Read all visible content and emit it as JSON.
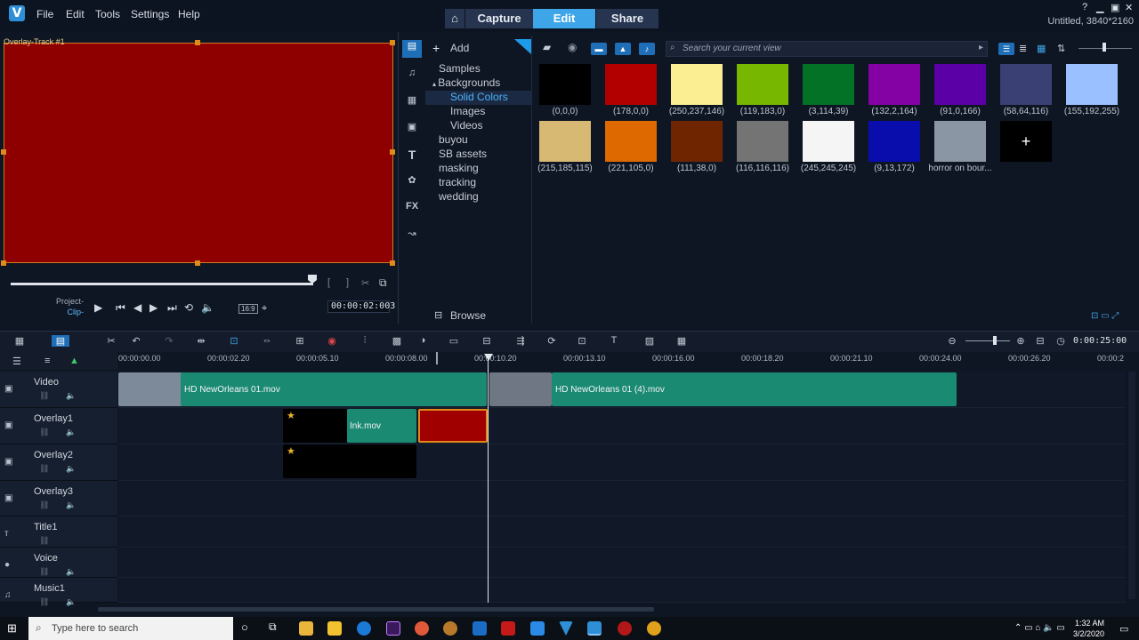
{
  "app": {
    "logo": "V",
    "menus": [
      "File",
      "Edit",
      "Tools",
      "Settings",
      "Help"
    ],
    "workspaces": [
      "Capture",
      "Edit",
      "Share"
    ],
    "active_workspace": "Edit",
    "project_info": "Untitled, 3840*2160"
  },
  "preview": {
    "track_label": "Overlay-Track #1",
    "canvas_color": "#8e0000",
    "project_label": "Project-",
    "clip_label": "Clip-",
    "aspect": "16:9",
    "timecode": "00:00:02:003"
  },
  "library": {
    "add_label": "Add",
    "search_placeholder": "Search your current view",
    "browse_label": "Browse",
    "tree": [
      {
        "label": "Samples",
        "indent": 1
      },
      {
        "label": "Backgrounds",
        "indent": 1,
        "arrow": "▴"
      },
      {
        "label": "Solid Colors",
        "indent": 2,
        "selected": true
      },
      {
        "label": "Images",
        "indent": 2
      },
      {
        "label": "Videos",
        "indent": 2
      },
      {
        "label": "buyou",
        "indent": 0
      },
      {
        "label": "SB assets",
        "indent": 0
      },
      {
        "label": "masking",
        "indent": 0
      },
      {
        "label": "tracking",
        "indent": 0
      },
      {
        "label": "wedding",
        "indent": 0
      }
    ],
    "swatches": [
      {
        "label": "(0,0,0)",
        "color": "#000000"
      },
      {
        "label": "(178,0,0)",
        "color": "#b20000"
      },
      {
        "label": "(250,237,146)",
        "color": "#faed92"
      },
      {
        "label": "(119,183,0)",
        "color": "#77b700"
      },
      {
        "label": "(3,114,39)",
        "color": "#037227"
      },
      {
        "label": "(132,2,164)",
        "color": "#8402a4"
      },
      {
        "label": "(91,0,166)",
        "color": "#5b00a6"
      },
      {
        "label": "(58,64,116)",
        "color": "#3a4074"
      },
      {
        "label": "(155,192,255)",
        "color": "#9bc0ff"
      },
      {
        "label": "(215,185,115)",
        "color": "#d7b973"
      },
      {
        "label": "(221,105,0)",
        "color": "#dd6900"
      },
      {
        "label": "(111,38,0)",
        "color": "#6f2600"
      },
      {
        "label": "(116,116,116)",
        "color": "#747474"
      },
      {
        "label": "(245,245,245)",
        "color": "#f5f5f5"
      },
      {
        "label": "(9,13,172)",
        "color": "#090dac"
      },
      {
        "label": "horror on bour...",
        "color": "#8a96a4"
      },
      {
        "label": "",
        "color": "#000000",
        "plus": "+"
      }
    ]
  },
  "timeline": {
    "zoom_time": "0:00:25:00",
    "ticks": [
      "00:00:00.00",
      "00:00:02.20",
      "00:00:05.10",
      "00:00:08.00",
      "00:00:10.20",
      "00:00:13.10",
      "00:00:16.00",
      "00:00:18.20",
      "00:00:21.10",
      "00:00:24.00",
      "00:00:26.20",
      "00:00:2"
    ],
    "tracks": [
      "Video",
      "Overlay1",
      "Overlay2",
      "Overlay3",
      "Title1",
      "Voice",
      "Music1"
    ],
    "clips": {
      "video1": "HD NewOrleans 01.mov",
      "video2": "HD NewOrleans 01 (4).mov",
      "ink": "Ink.mov"
    }
  },
  "taskbar": {
    "search": "Type here to search",
    "time": "1:32 AM",
    "date": "3/2/2020"
  }
}
